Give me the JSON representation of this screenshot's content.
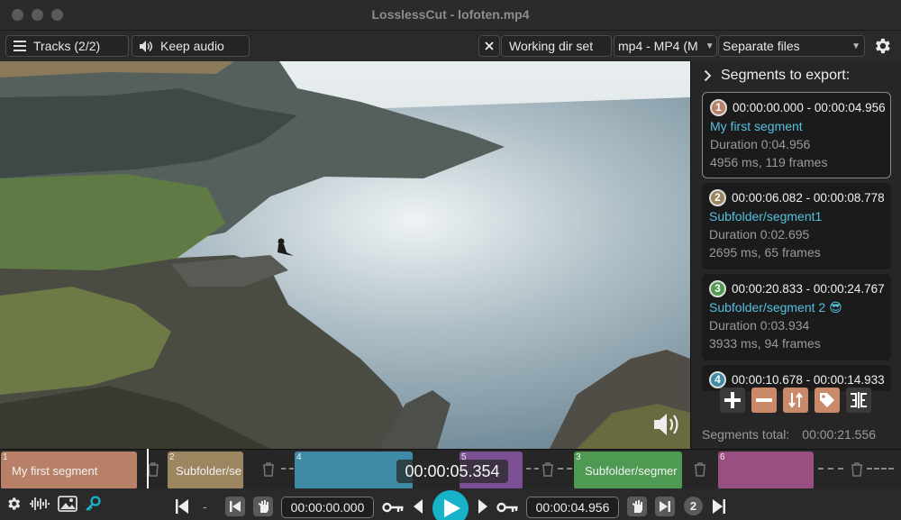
{
  "window": {
    "title": "LosslessCut - lofoten.mp4"
  },
  "toolbar": {
    "tracks_label": "Tracks (2/2)",
    "audio_label": "Keep audio",
    "workdir_label": "Working dir set",
    "format_label": "mp4 - MP4 (M",
    "output_mode_label": "Separate files"
  },
  "panel": {
    "heading": "Segments to export:",
    "segments": [
      {
        "num": "1",
        "range": "00:00:00.000 - 00:00:04.956",
        "name": "My first segment",
        "duration": "Duration 0:04.956",
        "detail": "4956 ms, 119 frames",
        "color": "#b98068"
      },
      {
        "num": "2",
        "range": "00:00:06.082 - 00:00:08.778",
        "name": "Subfolder/segment1",
        "duration": "Duration 0:02.695",
        "detail": "2695 ms, 65 frames",
        "color": "#9b8660"
      },
      {
        "num": "3",
        "range": "00:00:20.833 - 00:00:24.767",
        "name": "Subfolder/segment 2 😎",
        "duration": "Duration 0:03.934",
        "detail": "3933 ms, 94 frames",
        "color": "#4f9a52"
      },
      {
        "num": "4",
        "range": "00:00:10.678 - 00:00:14.933",
        "name": "",
        "duration": "",
        "detail": "",
        "color": "#3f8ba5"
      }
    ],
    "total_label": "Segments total:",
    "total_value": "00:00:21.556"
  },
  "timeline": {
    "segments": [
      {
        "idx": "1",
        "label": "My first segment",
        "color": "#b98068"
      },
      {
        "idx": "2",
        "label": "Subfolder/se",
        "color": "#9b8660"
      },
      {
        "idx": "4",
        "label": "",
        "color": "#3f8ba5"
      },
      {
        "idx": "5",
        "label": "",
        "color": "#7b4f93"
      },
      {
        "idx": "3",
        "label": "Subfolder/segmer",
        "color": "#4f9a52"
      },
      {
        "idx": "6",
        "label": "",
        "color": "#9a4f82"
      }
    ],
    "current_time": "00:00:05.354"
  },
  "bottombar": {
    "cut_start": "00:00:00.000",
    "cut_end": "00:00:04.956",
    "segment_number": "2",
    "accent": "#17b4c9"
  }
}
